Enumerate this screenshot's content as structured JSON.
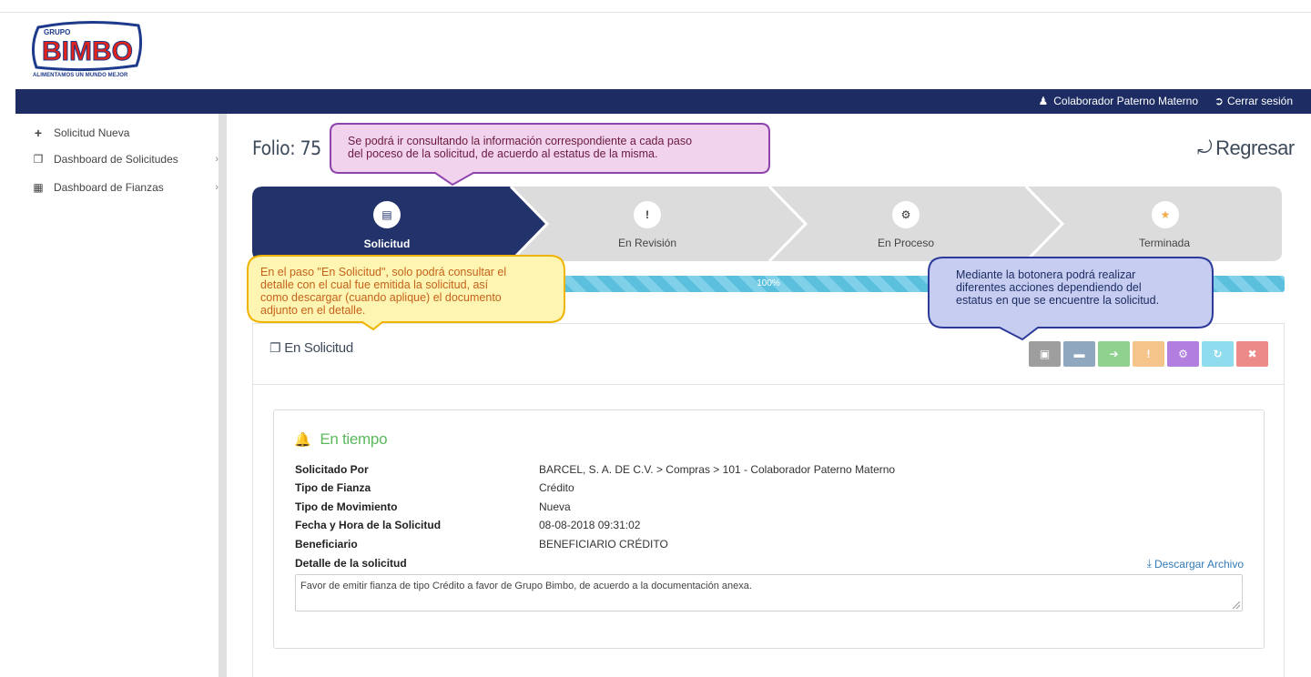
{
  "brand": {
    "logo_top": "GRUPO",
    "logo_main": "BIMBO",
    "tagline": "ALIMENTAMOS UN MUNDO MEJOR"
  },
  "navbar": {
    "user_name": "Colaborador Paterno Materno",
    "logout_label": "Cerrar sesión"
  },
  "sidebar": {
    "items": [
      {
        "label": "Solicitud Nueva",
        "icon": "plus-icon"
      },
      {
        "label": "Dashboard de Solicitudes",
        "icon": "documents-icon"
      },
      {
        "label": "Dashboard de Fianzas",
        "icon": "table-icon"
      }
    ]
  },
  "header": {
    "folio": "Folio: 75",
    "back_label": "Regresar"
  },
  "steps": [
    {
      "label": "Solicitud",
      "icon": "document-icon",
      "glyph": "▤",
      "active": true
    },
    {
      "label": "En Revisión",
      "icon": "exclamation-icon",
      "glyph": "!",
      "active": false
    },
    {
      "label": "En Proceso",
      "icon": "gears-icon",
      "glyph": "⚙",
      "active": false
    },
    {
      "label": "Terminada",
      "icon": "star-icon",
      "glyph": "★",
      "active": false
    }
  ],
  "progress": {
    "value": 100,
    "label": "100%"
  },
  "panel": {
    "title": "En Solicitud"
  },
  "toolbar": {
    "buttons": [
      {
        "name": "pdf-button",
        "glyph": "▣",
        "color": "#9e9e9e"
      },
      {
        "name": "comment-button",
        "glyph": "▬",
        "color": "#8fa8c0"
      },
      {
        "name": "forward-button",
        "glyph": "➔",
        "color": "#8fd18f"
      },
      {
        "name": "alert-button",
        "glyph": "!",
        "color": "#f5c48a"
      },
      {
        "name": "process-button",
        "glyph": "⚙",
        "color": "#b27ee0"
      },
      {
        "name": "refresh-button",
        "glyph": "↻",
        "color": "#8fdcef"
      },
      {
        "name": "cancel-button",
        "glyph": "✖",
        "color": "#ec8a8a"
      }
    ]
  },
  "card": {
    "status": "En tiempo",
    "fields": [
      {
        "key": "Solicitado Por",
        "value": "BARCEL, S. A. DE C.V.  >  Compras  >  101  -  Colaborador Paterno Materno"
      },
      {
        "key": "Tipo de Fianza",
        "value": "Crédito"
      },
      {
        "key": "Tipo de Movimiento",
        "value": "Nueva"
      },
      {
        "key": "Fecha y Hora de la Solicitud",
        "value": "08-08-2018 09:31:02"
      },
      {
        "key": "Beneficiario",
        "value": "BENEFICIARIO CRÉDITO"
      }
    ],
    "detail_label": "Detalle de la solicitud",
    "download_label": "Descargar Archivo",
    "detail_text": "Favor de emitir fianza de tipo Crédito a favor de Grupo Bimbo, de acuerdo a la documentación anexa."
  },
  "callouts": {
    "top": "Se podrá ir consultando la información correspondiente a cada paso\ndel poceso de la solicitud, de acuerdo al estatus de la misma.",
    "left": "En el paso \"En Solicitud\", solo podrá consultar el\ndetalle con el cual fue emitida la solicitud, así\ncomo descargar (cuando aplique) el documento\nadjunto en el detalle.",
    "right": "Mediante la botonera podrá realizar\ndiferentes acciones dependiendo del\nestatus en que se encuentre la solicitud."
  },
  "colors": {
    "navbar": "#1d2d64",
    "active_step": "#22336b",
    "inactive_step": "#dcdcdc",
    "progress": "#5bc0de",
    "status_green": "#5cb85c",
    "link": "#337ab7"
  }
}
